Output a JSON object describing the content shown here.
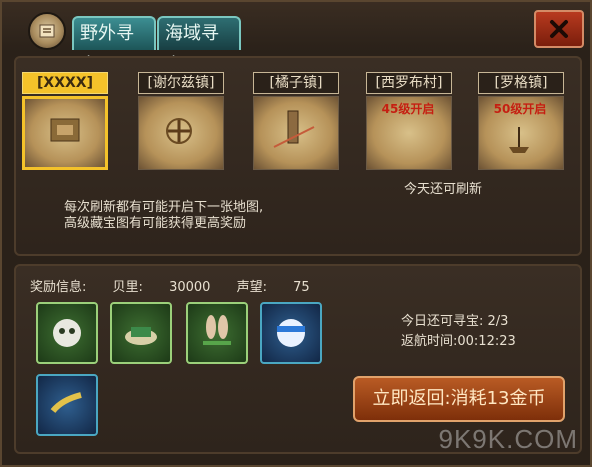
{
  "tabs": [
    {
      "label": "野外寻宝"
    },
    {
      "label": "海域寻宝"
    }
  ],
  "maps": [
    {
      "label": "[XXXX]",
      "selected": true,
      "status": ""
    },
    {
      "label": "[谢尔兹镇]",
      "selected": false,
      "status": ""
    },
    {
      "label": "[橘子镇]",
      "selected": false,
      "status": ""
    },
    {
      "label": "[西罗布村]",
      "selected": false,
      "status": "45级开启"
    },
    {
      "label": "[罗格镇]",
      "selected": false,
      "status": "50级开启"
    }
  ],
  "notes": {
    "line1": "每次刷新都有可能开启下一张地图,",
    "line2": "高级藏宝图有可能获得更高奖励",
    "refresh": "今天还可刷新"
  },
  "reward": {
    "label": "奖励信息:",
    "berries_label": "贝里:",
    "berries_value": "30000",
    "fame_label": "声望:",
    "fame_value": "75"
  },
  "items": [
    {
      "icon": "skull-bandana-icon"
    },
    {
      "icon": "green-hat-icon"
    },
    {
      "icon": "bunny-ears-icon"
    },
    {
      "icon": "blue-bandana-icon"
    },
    {
      "icon": "gold-bracelet-icon"
    }
  ],
  "stats": {
    "treasure_left": "今日还可寻宝: 2/3",
    "return_time": "返航时间:00:12:23"
  },
  "return_button": "立即返回:消耗13金币",
  "watermark": "9K9K.COM"
}
